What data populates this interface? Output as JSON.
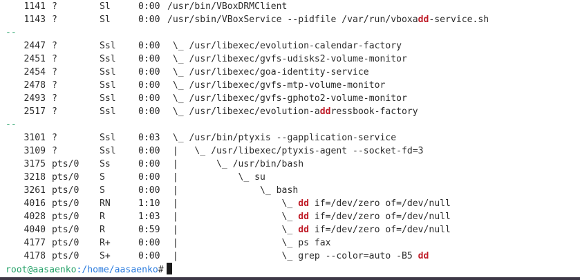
{
  "terminal": {
    "separator": "--",
    "prompt": {
      "user_host": "root@aasaenko",
      "path": ":/home/aasaenko",
      "symbol": "#"
    },
    "blocks": [
      {
        "rows": [
          {
            "pid": "1141",
            "tty": "?",
            "stat": "Sl",
            "time": "0:00",
            "tree": "",
            "cmd_parts": [
              {
                "t": "/usr/bin/VBoxDRMClient",
                "h": false
              }
            ]
          },
          {
            "pid": "1143",
            "tty": "?",
            "stat": "Sl",
            "time": "0:00",
            "tree": "",
            "cmd_parts": [
              {
                "t": "/usr/sbin/VBoxService --pidfile /var/run/vboxa",
                "h": false
              },
              {
                "t": "dd",
                "h": true
              },
              {
                "t": "-service.sh",
                "h": false
              }
            ]
          }
        ]
      },
      {
        "rows": [
          {
            "pid": "2447",
            "tty": "?",
            "stat": "Ssl",
            "time": "0:00",
            "tree": " \\_ ",
            "cmd_parts": [
              {
                "t": "/usr/libexec/evolution-calendar-factory",
                "h": false
              }
            ]
          },
          {
            "pid": "2451",
            "tty": "?",
            "stat": "Ssl",
            "time": "0:00",
            "tree": " \\_ ",
            "cmd_parts": [
              {
                "t": "/usr/libexec/gvfs-udisks2-volume-monitor",
                "h": false
              }
            ]
          },
          {
            "pid": "2454",
            "tty": "?",
            "stat": "Ssl",
            "time": "0:00",
            "tree": " \\_ ",
            "cmd_parts": [
              {
                "t": "/usr/libexec/goa-identity-service",
                "h": false
              }
            ]
          },
          {
            "pid": "2478",
            "tty": "?",
            "stat": "Ssl",
            "time": "0:00",
            "tree": " \\_ ",
            "cmd_parts": [
              {
                "t": "/usr/libexec/gvfs-mtp-volume-monitor",
                "h": false
              }
            ]
          },
          {
            "pid": "2493",
            "tty": "?",
            "stat": "Ssl",
            "time": "0:00",
            "tree": " \\_ ",
            "cmd_parts": [
              {
                "t": "/usr/libexec/gvfs-gphoto2-volume-monitor",
                "h": false
              }
            ]
          },
          {
            "pid": "2517",
            "tty": "?",
            "stat": "Ssl",
            "time": "0:00",
            "tree": " \\_ ",
            "cmd_parts": [
              {
                "t": "/usr/libexec/evolution-a",
                "h": false
              },
              {
                "t": "dd",
                "h": true
              },
              {
                "t": "ressbook-factory",
                "h": false
              }
            ]
          }
        ]
      },
      {
        "rows": [
          {
            "pid": "3101",
            "tty": "?",
            "stat": "Ssl",
            "time": "0:03",
            "tree": " \\_ ",
            "cmd_parts": [
              {
                "t": "/usr/bin/ptyxis --gapplication-service",
                "h": false
              }
            ]
          },
          {
            "pid": "3109",
            "tty": "?",
            "stat": "Ssl",
            "time": "0:00",
            "tree": " |   \\_ ",
            "cmd_parts": [
              {
                "t": "/usr/libexec/ptyxis-agent --socket-fd=3",
                "h": false
              }
            ]
          },
          {
            "pid": "3175",
            "tty": "pts/0",
            "stat": "Ss",
            "time": "0:00",
            "tree": " |       \\_ ",
            "cmd_parts": [
              {
                "t": "/usr/bin/bash",
                "h": false
              }
            ]
          },
          {
            "pid": "3218",
            "tty": "pts/0",
            "stat": "S",
            "time": "0:00",
            "tree": " |           \\_ ",
            "cmd_parts": [
              {
                "t": "su",
                "h": false
              }
            ]
          },
          {
            "pid": "3261",
            "tty": "pts/0",
            "stat": "S",
            "time": "0:00",
            "tree": " |               \\_ ",
            "cmd_parts": [
              {
                "t": "bash",
                "h": false
              }
            ]
          },
          {
            "pid": "4016",
            "tty": "pts/0",
            "stat": "RN",
            "time": "1:10",
            "tree": " |                   \\_ ",
            "cmd_parts": [
              {
                "t": "dd",
                "h": true
              },
              {
                "t": " if=/dev/zero of=/dev/null",
                "h": false
              }
            ]
          },
          {
            "pid": "4028",
            "tty": "pts/0",
            "stat": "R",
            "time": "1:03",
            "tree": " |                   \\_ ",
            "cmd_parts": [
              {
                "t": "dd",
                "h": true
              },
              {
                "t": " if=/dev/zero of=/dev/null",
                "h": false
              }
            ]
          },
          {
            "pid": "4040",
            "tty": "pts/0",
            "stat": "R",
            "time": "0:59",
            "tree": " |                   \\_ ",
            "cmd_parts": [
              {
                "t": "dd",
                "h": true
              },
              {
                "t": " if=/dev/zero of=/dev/null",
                "h": false
              }
            ]
          },
          {
            "pid": "4177",
            "tty": "pts/0",
            "stat": "R+",
            "time": "0:00",
            "tree": " |                   \\_ ",
            "cmd_parts": [
              {
                "t": "ps fax",
                "h": false
              }
            ]
          },
          {
            "pid": "4178",
            "tty": "pts/0",
            "stat": "S+",
            "time": "0:00",
            "tree": " |                   \\_ ",
            "cmd_parts": [
              {
                "t": "grep --color=auto -B5 ",
                "h": false
              },
              {
                "t": "dd",
                "h": true
              }
            ]
          }
        ]
      }
    ]
  }
}
